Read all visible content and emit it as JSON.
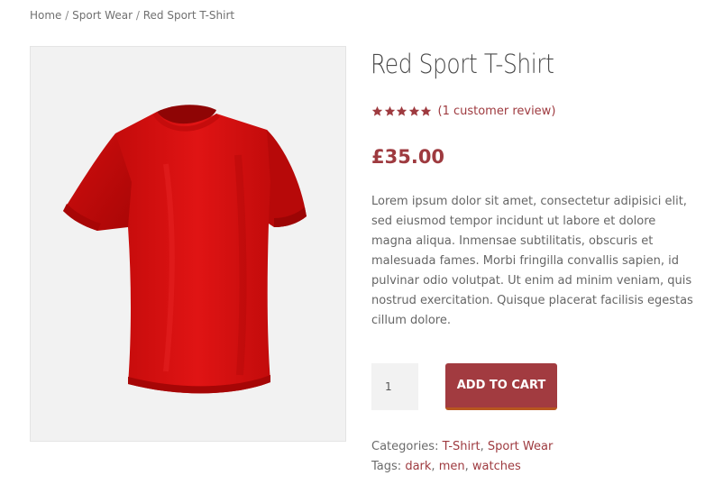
{
  "breadcrumb": {
    "home": "Home",
    "separator": "/",
    "category": "Sport Wear",
    "current": "Red Sport T-Shirt"
  },
  "product": {
    "title": "Red Sport T-Shirt",
    "rating": 5,
    "rating_max": 5,
    "review_link": "(1 customer review)",
    "price": "£35.00",
    "description": "Lorem ipsum dolor sit amet, consectetur adipisici elit, sed eiusmod tempor incidunt ut labore et dolore magna aliqua. Inmensae subtilitatis, obscuris et malesuada fames. Morbi fringilla convallis sapien, id pulvinar odio volutpat. Ut enim ad minim veniam, quis nostrud exercitation. Quisque placerat facilisis egestas cillum dolore.",
    "quantity": "1",
    "add_to_cart": "ADD TO CART",
    "image_icon": "red-tshirt-icon"
  },
  "meta": {
    "categories_label": "Categories:",
    "categories": [
      "T-Shirt",
      "Sport Wear"
    ],
    "tags_label": "Tags:",
    "tags": [
      "dark",
      "men",
      "watches"
    ],
    "comma": ","
  },
  "colors": {
    "accent": "#9e3a3f",
    "button": "#a23b40",
    "button_border": "#b8561f",
    "shirt": "#d81010",
    "image_bg": "#f2f2f2"
  }
}
